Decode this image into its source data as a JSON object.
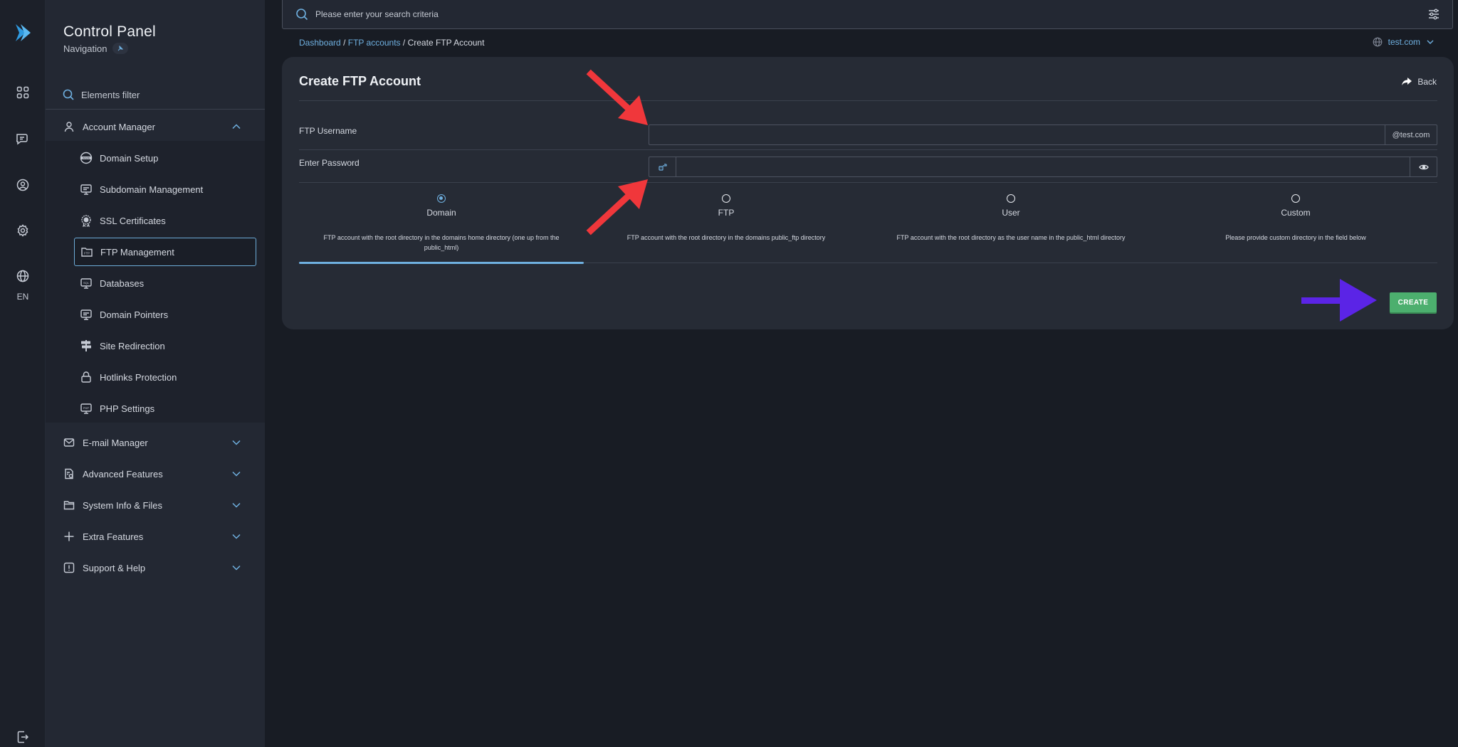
{
  "rail": {
    "lang": "EN"
  },
  "sidebar": {
    "title": "Control Panel",
    "subtitle": "Navigation",
    "filter_label": "Elements filter",
    "groups": [
      {
        "label": "Account Manager",
        "expanded": true
      },
      {
        "label": "E-mail Manager",
        "expanded": false
      },
      {
        "label": "Advanced Features",
        "expanded": false
      },
      {
        "label": "System Info & Files",
        "expanded": false
      },
      {
        "label": "Extra Features",
        "expanded": false
      },
      {
        "label": "Support & Help",
        "expanded": false
      }
    ],
    "account_items": [
      {
        "label": "Domain Setup",
        "icon": "www-icon"
      },
      {
        "label": "Subdomain Management",
        "icon": "monitor-icon"
      },
      {
        "label": "SSL Certificates",
        "icon": "certificate-icon"
      },
      {
        "label": "FTP Management",
        "icon": "folder-ftp-icon",
        "active": true
      },
      {
        "label": "Databases",
        "icon": "database-icon"
      },
      {
        "label": "Domain Pointers",
        "icon": "monitor-icon"
      },
      {
        "label": "Site Redirection",
        "icon": "signpost-icon"
      },
      {
        "label": "Hotlinks Protection",
        "icon": "lock-icon"
      },
      {
        "label": "PHP Settings",
        "icon": "php-icon"
      }
    ]
  },
  "search": {
    "placeholder": "Please enter your search criteria"
  },
  "breadcrumb": {
    "dashboard": "Dashboard",
    "sep1": "/",
    "ftp_accounts": "FTP accounts",
    "sep2": "/",
    "current": "Create FTP Account"
  },
  "domain_selector": {
    "value": "test.com"
  },
  "form": {
    "title": "Create FTP Account",
    "back_label": "Back",
    "username_label": "FTP Username",
    "username_value": "",
    "username_suffix": "@test.com",
    "password_label": "Enter Password",
    "password_value": "",
    "options": [
      {
        "name": "Domain",
        "desc": "FTP account with the root directory in the domains home directory (one up from the public_html)",
        "selected": true
      },
      {
        "name": "FTP",
        "desc": "FTP account with the root directory in the domains public_ftp directory",
        "selected": false
      },
      {
        "name": "User",
        "desc": "FTP account with the root directory as the user name in the public_html directory",
        "selected": false
      },
      {
        "name": "Custom",
        "desc": "Please provide custom directory in the field below",
        "selected": false
      }
    ],
    "create_label": "CREATE"
  },
  "colors": {
    "accent": "#6fb0e0",
    "create": "#4caf6e",
    "annotation_red": "#f0373b",
    "annotation_purple": "#5b24e6",
    "background": "#181c24",
    "card": "#262b35"
  }
}
